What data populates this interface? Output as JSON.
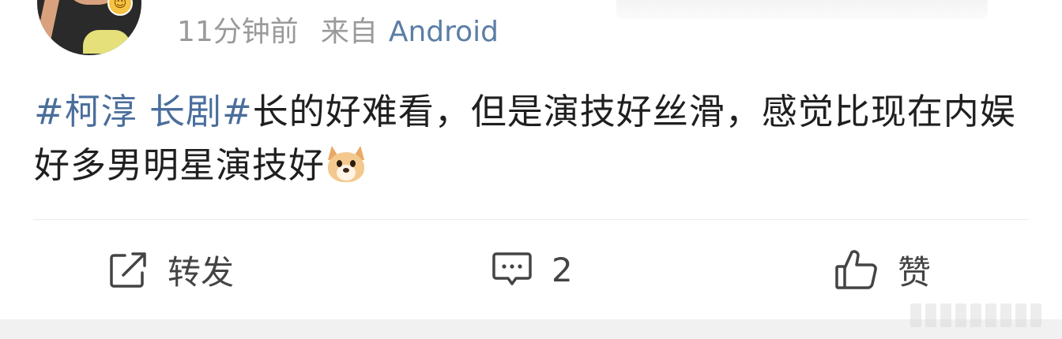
{
  "post": {
    "time": "11分钟前",
    "from_label": "来自",
    "source": "Android",
    "hashtag": "#柯淳 长剧#",
    "body_text": "长的好难看，但是演技好丝滑，感觉比现在内娱好多男明星演技好",
    "emoji": "dog-face-emoji",
    "avatar_badge": "grinning-face-emoji"
  },
  "actions": {
    "repost_label": "转发",
    "comment_count": "2",
    "like_label": "赞"
  },
  "colors": {
    "hashtag": "#4a6e9c",
    "source": "#5b7ea6",
    "meta": "#9a9a9a",
    "text": "#1f1f1f",
    "icon": "#444444"
  }
}
